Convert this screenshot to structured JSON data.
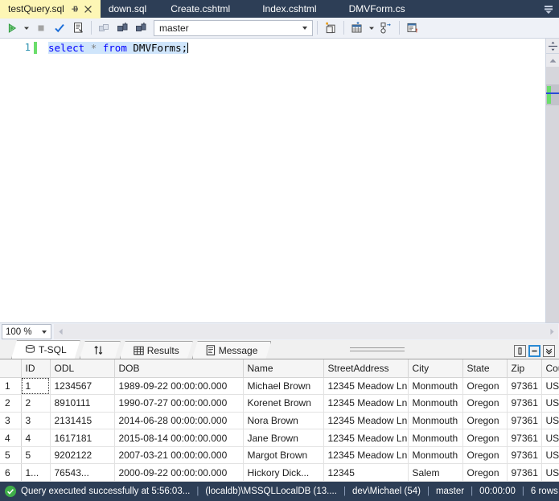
{
  "window": {
    "tabs": [
      {
        "label": "testQuery.sql",
        "active": true
      },
      {
        "label": "down.sql",
        "active": false
      },
      {
        "label": "Create.cshtml",
        "active": false
      },
      {
        "label": "Index.cshtml",
        "active": false
      },
      {
        "label": "DMVForm.cs",
        "active": false
      }
    ],
    "tab_pin_icon": "pin-icon",
    "tab_close_icon": "close-icon",
    "tab_overflow_icon": "chevron-down-icon",
    "active_tab_bg": "#fdf6b5",
    "chrome_bg": "#2d3e56"
  },
  "toolbar": {
    "execute_icon": "play-icon",
    "execute_dropdown_icon": "chevron-down-icon",
    "stop_icon": "stop-square-icon",
    "parse_icon": "checkmark-icon",
    "query_options_icon": "query-options-icon",
    "disconnect_icon": "disconnect-icon",
    "connect_icon": "connect-icon",
    "change_connection_icon": "change-connection-icon",
    "database_value": "master",
    "database_caret_icon": "chevron-down-icon",
    "new_query_icon": "new-query-icon",
    "results_to_grid_icon": "results-grid-icon",
    "results_dropdown_icon": "chevron-down-icon",
    "execution_plan_icon": "execution-plan-icon",
    "results_to_text_icon": "results-text-icon"
  },
  "editor": {
    "line_number": "1",
    "code_tokens": [
      {
        "text": "select",
        "type": "kw"
      },
      {
        "text": " ",
        "type": "ws"
      },
      {
        "text": "*",
        "type": "op"
      },
      {
        "text": " ",
        "type": "ws"
      },
      {
        "text": "from",
        "type": "kw"
      },
      {
        "text": " ",
        "type": "ws"
      },
      {
        "text": "DMVForms",
        "type": "id"
      },
      {
        "text": ";",
        "type": "punct"
      }
    ],
    "code_text": "select * from DMVForms;",
    "zoom_value": "100 %",
    "zoom_caret_icon": "chevron-down-icon",
    "hscroll_left_icon": "triangle-left-icon",
    "hscroll_right_icon": "triangle-right-icon",
    "vscroll_split_icon": "split-view-icon",
    "vscroll_up_icon": "triangle-up-icon"
  },
  "results_panel": {
    "tabs": [
      {
        "label": "T-SQL",
        "icon": "tsql-icon",
        "active": true
      },
      {
        "label": "",
        "icon": "sort-arrows-icon",
        "active": false
      },
      {
        "label": "Results",
        "icon": "grid-icon",
        "active": false
      },
      {
        "label": "Message",
        "icon": "message-icon",
        "active": false
      }
    ],
    "grip_icon": "drag-grip-icon",
    "window_buttons": [
      {
        "name": "restore-button",
        "glyph": "▯",
        "selected": false
      },
      {
        "name": "minimize-button",
        "glyph": "−",
        "selected": true
      },
      {
        "name": "close-dropdown-button",
        "glyph": "⌄",
        "selected": false
      }
    ],
    "columns": [
      "",
      "ID",
      "ODL",
      "DOB",
      "Name",
      "StreetAddress",
      "City",
      "State",
      "Zip",
      "Country"
    ],
    "rows": [
      {
        "num": "1",
        "cells": [
          "1",
          "1234567",
          "1989-09-22 00:00:00.000",
          "Michael Brown",
          "12345 Meadow Ln",
          "Monmouth",
          "Oregon",
          "97361",
          "USA"
        ],
        "selected_cell": 0
      },
      {
        "num": "2",
        "cells": [
          "2",
          "8910111",
          "1990-07-27 00:00:00.000",
          "Korenet Brown",
          "12345 Meadow Ln",
          "Monmouth",
          "Oregon",
          "97361",
          "USA"
        ],
        "selected_cell": -1
      },
      {
        "num": "3",
        "cells": [
          "3",
          "2131415",
          "2014-06-28 00:00:00.000",
          "Nora Brown",
          "12345 Meadow Ln",
          "Monmouth",
          "Oregon",
          "97361",
          "USA"
        ],
        "selected_cell": -1
      },
      {
        "num": "4",
        "cells": [
          "4",
          "1617181",
          "2015-08-14 00:00:00.000",
          "Jane Brown",
          "12345 Meadow Ln",
          "Monmouth",
          "Oregon",
          "97361",
          "USA"
        ],
        "selected_cell": -1
      },
      {
        "num": "5",
        "cells": [
          "5",
          "9202122",
          "2007-03-21 00:00:00.000",
          "Margot Brown",
          "12345 Meadow Ln",
          "Monmouth",
          "Oregon",
          "97361",
          "USA"
        ],
        "selected_cell": -1
      },
      {
        "num": "6",
        "cells": [
          "1...",
          "76543...",
          "2000-09-22 00:00:00.000",
          "Hickory Dick...",
          "12345",
          "Salem",
          "Oregon",
          "97361",
          "USA"
        ],
        "selected_cell": -1
      }
    ]
  },
  "statusbar": {
    "status_icon": "success-check-icon",
    "message": "Query executed successfully at 5:56:03...",
    "server": "(localdb)\\MSSQLLocalDB (13....",
    "user": "dev\\Michael (54)",
    "database": "master",
    "elapsed": "00:00:00",
    "rowcount": "6 rows",
    "separator": "|"
  }
}
